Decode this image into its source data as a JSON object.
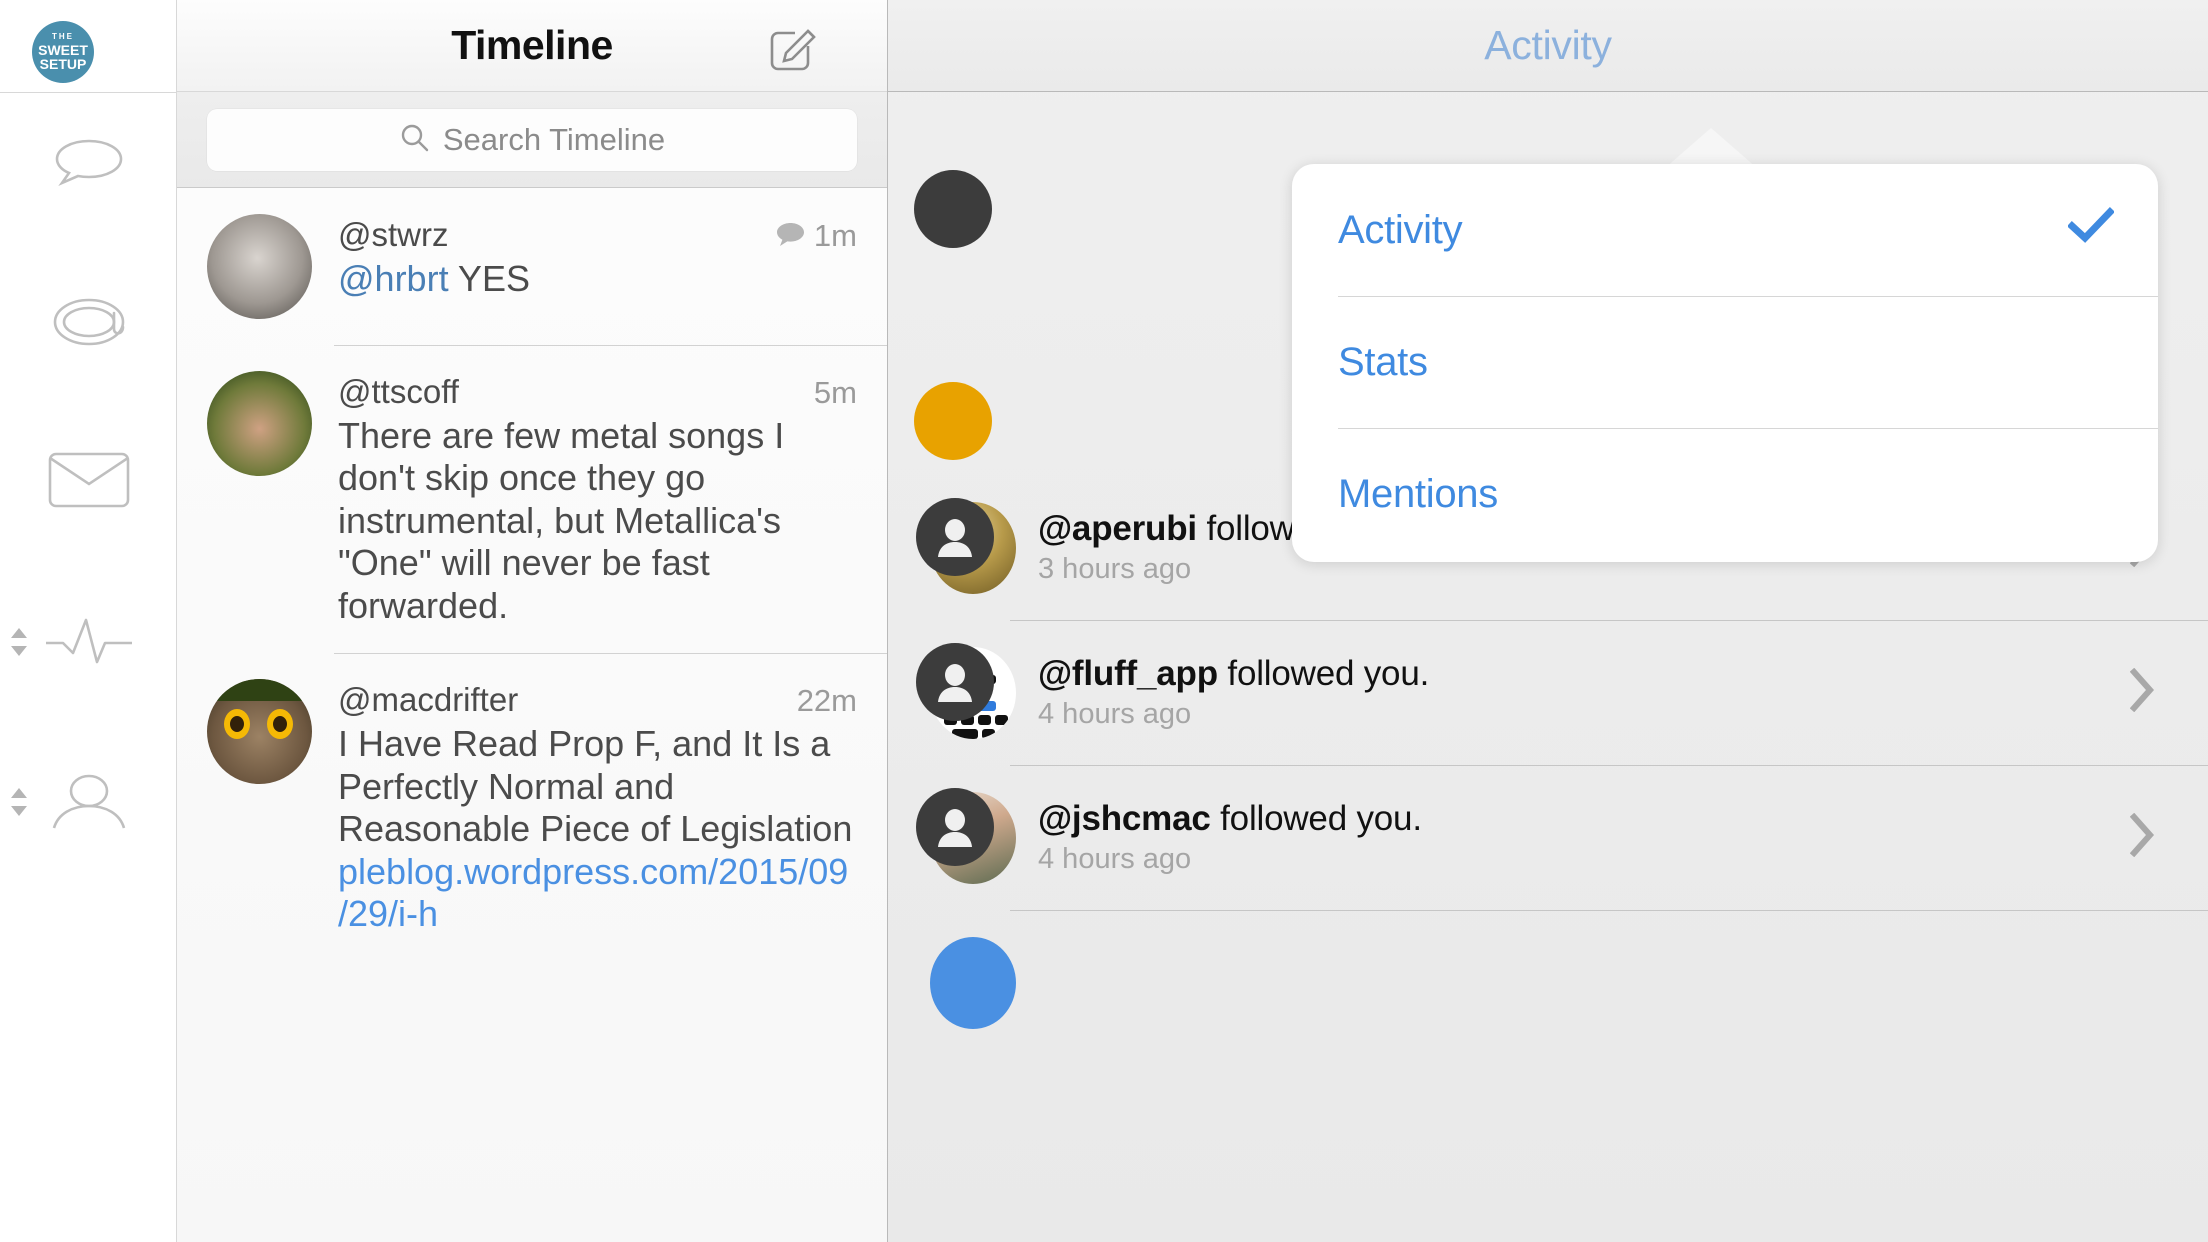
{
  "brand": {
    "logo_line1": "THE",
    "logo_line2": "SWEET",
    "logo_line3": "SETUP",
    "accent_blue": "#4a90e2",
    "logo_bg": "#4a8fad"
  },
  "sidebar": {
    "items": [
      {
        "name": "conversations",
        "icon": "speech-bubble-icon",
        "has_stepper": false
      },
      {
        "name": "mentions",
        "icon": "at-symbol-icon",
        "has_stepper": false
      },
      {
        "name": "messages",
        "icon": "envelope-icon",
        "has_stepper": false
      },
      {
        "name": "activity",
        "icon": "pulse-line-icon",
        "has_stepper": true
      },
      {
        "name": "profile",
        "icon": "person-icon",
        "has_stepper": true
      }
    ]
  },
  "timeline": {
    "title": "Timeline",
    "compose_icon": "compose-pencil-icon",
    "search": {
      "placeholder": "Search Timeline",
      "value": "",
      "icon": "search-icon"
    },
    "posts": [
      {
        "user": "@stwrz",
        "time": "1m",
        "reply_icon": "speech-bubble-icon",
        "has_reply_icon": true,
        "mention": "@hrbrt",
        "text": " YES",
        "link": "",
        "avatar": "av-stwrz"
      },
      {
        "user": "@ttscoff",
        "time": "5m",
        "has_reply_icon": false,
        "mention": "",
        "text": "There are few metal songs I don't skip once they go instrumental, but Metallica's \"One\" will never be fast forwarded.",
        "link": "",
        "avatar": "av-ttscoff"
      },
      {
        "user": "@macdrifter",
        "time": "22m",
        "has_reply_icon": false,
        "mention": "",
        "text": "I Have Read Prop F, and It Is a Perfectly Normal and Reasonable Piece of Legislation ",
        "link": "pleblog.wordpress.com/2015/09/29/i-h",
        "avatar": "av-macdrifter"
      }
    ]
  },
  "activity": {
    "title": "Activity",
    "items": [
      {
        "user": "@aperubi",
        "action": " followed you.",
        "time": "3 hours ago",
        "avatar_class": "ph-aperubi",
        "chevron": "chevron-right-icon"
      },
      {
        "user": "@fluff_app",
        "action": " followed you.",
        "time": "4 hours ago",
        "avatar_class": "ph-fluff",
        "chevron": "chevron-right-icon"
      },
      {
        "user": "@jshcmac",
        "action": " followed you.",
        "time": "4 hours ago",
        "avatar_class": "ph-jshcmac",
        "chevron": "chevron-right-icon"
      }
    ]
  },
  "popover": {
    "options": [
      {
        "label": "Activity",
        "selected": true,
        "check_icon": "checkmark-icon"
      },
      {
        "label": "Stats",
        "selected": false,
        "check_icon": ""
      },
      {
        "label": "Mentions",
        "selected": false,
        "check_icon": ""
      }
    ]
  }
}
